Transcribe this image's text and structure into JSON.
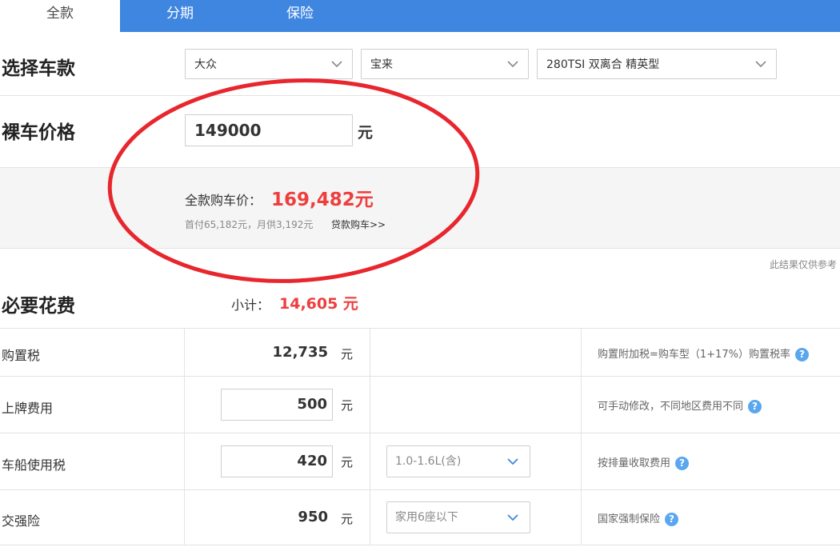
{
  "tabs": [
    {
      "label": "全款",
      "active": true
    },
    {
      "label": "分期"
    },
    {
      "label": "保险"
    }
  ],
  "select_car": {
    "title": "选择车款",
    "brand": "大众",
    "series": "宝来",
    "model": "280TSI 双离合 精英型"
  },
  "bare_price": {
    "title": "裸车价格",
    "value": "149000",
    "unit": "元"
  },
  "summary": {
    "total_label": "全款购车价：",
    "total_value": "169,482元",
    "sub_text": "首付65,182元，月供3,192元",
    "loan_link": "贷款购车>>"
  },
  "note": "此结果仅供参考",
  "required_fees": {
    "title": "必要花费",
    "subtotal_label": "小计：",
    "subtotal_value": "14,605 元",
    "rows": [
      {
        "label": "购置税",
        "value": "12,735",
        "unit": "元",
        "hint": "购置附加税=购车型（1+17%）购置税率"
      },
      {
        "label": "上牌费用",
        "value": "500",
        "unit": "元",
        "hint": "可手动修改，不同地区费用不同"
      },
      {
        "label": "车船使用税",
        "value": "420",
        "unit": "元",
        "option": "1.0-1.6L(含)",
        "hint": "按排量收取费用"
      },
      {
        "label": "交强险",
        "value": "950",
        "unit": "元",
        "option": "家用6座以下",
        "hint": "国家强制保险"
      }
    ]
  },
  "colors": {
    "tab_bar": "#3f86e0",
    "accent_red": "#ee3e3e",
    "help_icon": "#5aa7ef",
    "annotation": "#e8262e"
  }
}
